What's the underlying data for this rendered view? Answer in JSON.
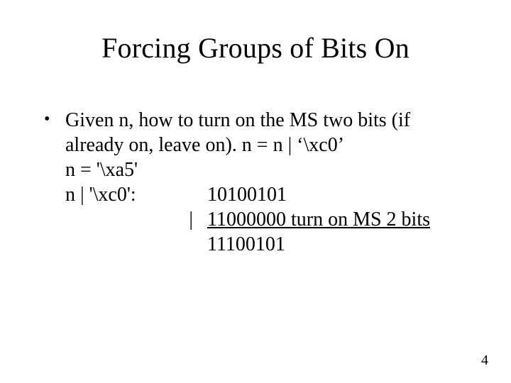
{
  "slide": {
    "title": "Forcing Groups of Bits On",
    "bullet_marker": "•",
    "line1": "Given n, how to turn on the MS two bits (if already on, leave on).  n = n | ‘\\xc0’",
    "line2": "n = '\\xa5'",
    "row1_left": "n | '\\xc0':",
    "row1_right": "10100101",
    "row2_left": "           |",
    "row2_right": "11000000  turn on MS 2 bits",
    "row3_left": "",
    "row3_right": "11100101",
    "page_number": "4"
  }
}
